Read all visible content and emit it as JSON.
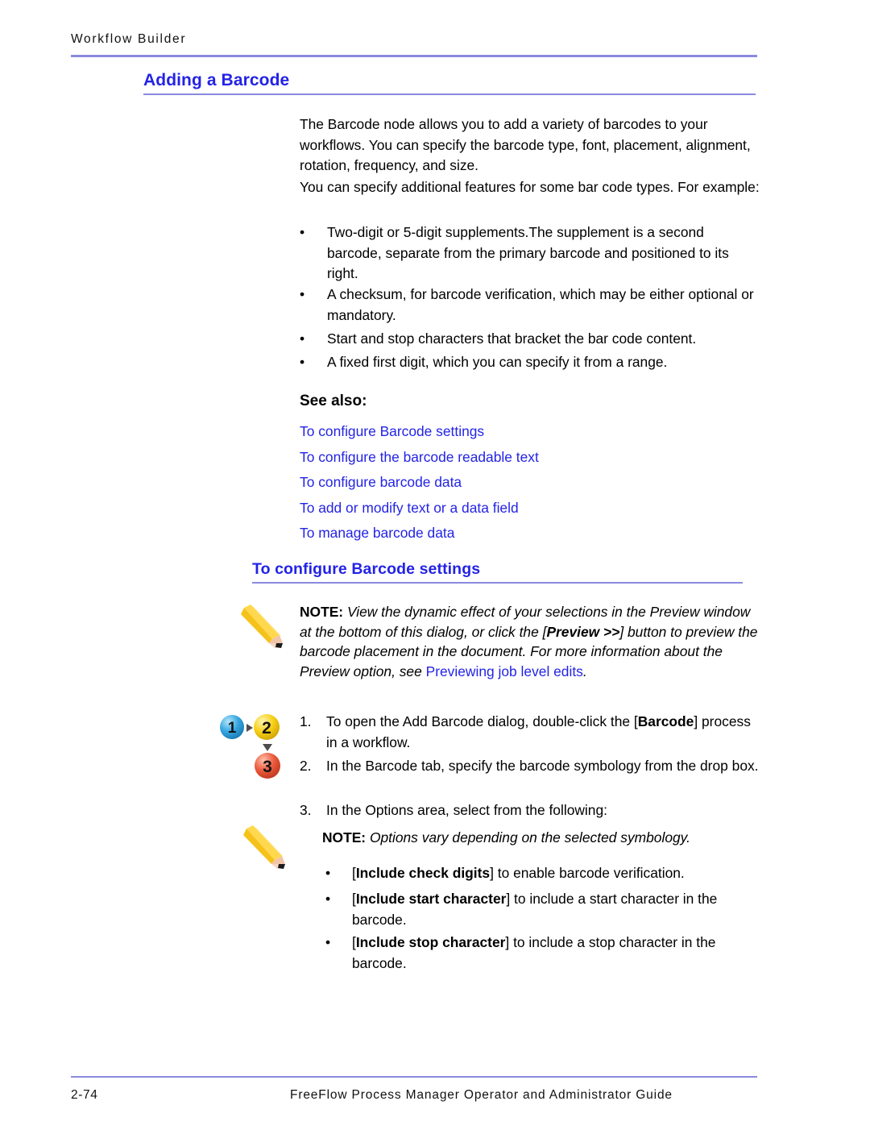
{
  "header": {
    "running_head": "Workflow  Builder"
  },
  "section1": {
    "title": "Adding a Barcode",
    "paragraphs": [
      "The Barcode node allows you to add a variety of barcodes to your workflows. You can specify the barcode type, font, placement, alignment, rotation, frequency, and size.",
      "You can specify additional features for some bar code types. For example:"
    ],
    "bullet_marker": "•",
    "bullets": [
      "Two-digit or 5-digit supplements.The supplement is a second barcode, separate from the primary barcode and positioned to its right.",
      "A checksum, for barcode verification, which may be either optional or mandatory.",
      "Start and stop characters that bracket the bar code content.",
      "A fixed first digit, which you can specify it from a range."
    ],
    "see_also_label": "See also:",
    "see_also_links": [
      "To configure Barcode settings",
      "To configure the barcode readable text",
      "To configure barcode data",
      "To add or modify text or a data field",
      "To manage barcode data"
    ]
  },
  "section2": {
    "title": "To configure Barcode settings",
    "note1": {
      "label": "NOTE:",
      "text_part1": " View the dynamic effect of your selections in the Preview window at the bottom of this dialog, or click the [",
      "bold_part": "Preview >>",
      "text_part2": "] button to preview the barcode placement in the document. For more information about the Preview option, see ",
      "link": "Previewing job level edits",
      "text_part3": "."
    },
    "steps": [
      {
        "number": "1.",
        "text_part1": "To open the Add Barcode dialog, double-click the [",
        "bold_part": "Barcode",
        "text_part2": "] process in a workflow."
      },
      {
        "number": "2.",
        "text_part1": "In the Barcode tab, specify the barcode symbology from the drop box.",
        "bold_part": "",
        "text_part2": ""
      },
      {
        "number": "3.",
        "text_part1": "In the Options area, select from the following:",
        "bold_part": "",
        "text_part2": ""
      }
    ],
    "note2": {
      "label": "NOTE:",
      "text": " Options vary depending on the selected symbology."
    },
    "option_bullet_marker": "•",
    "options": [
      {
        "open_bracket": "[",
        "bold_part": "Include check digits",
        "rest": "] to enable barcode verification."
      },
      {
        "open_bracket": "[",
        "bold_part": "Include start character",
        "rest": "] to include a start character in the barcode."
      },
      {
        "open_bracket": "[",
        "bold_part": "Include stop character",
        "rest": "] to include a stop character in the barcode."
      }
    ]
  },
  "icons": {
    "pencil": "pencil-icon",
    "steps_123": "numbered-steps-icon",
    "step_numbers": [
      "1",
      "2",
      "3"
    ],
    "step_colors": [
      "#3aa7e0",
      "#f7d117",
      "#ec5a3c"
    ]
  },
  "footer": {
    "page_number": "2-74",
    "document_title": "FreeFlow Process Manager Operator and Administrator Guide"
  },
  "colors": {
    "heading_blue": "#2323e6",
    "rule_blue": "#8a8ade",
    "link_blue": "#2323e6",
    "body_black": "#000000"
  }
}
